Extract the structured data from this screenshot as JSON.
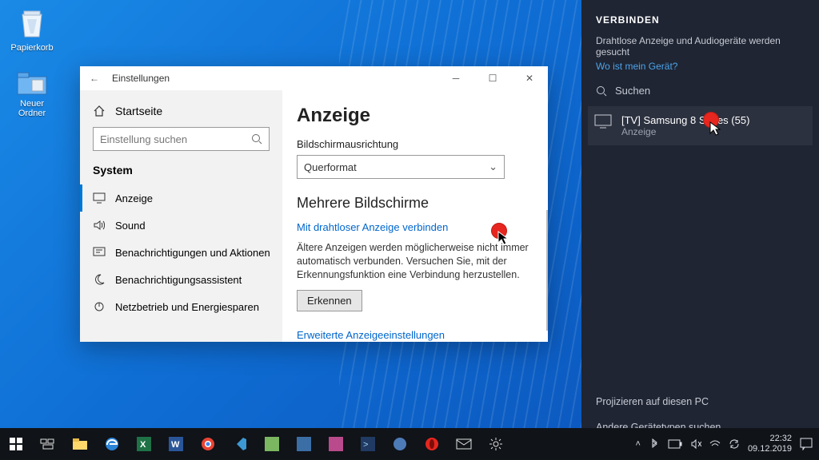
{
  "desktop_icons": {
    "recycle": "Papierkorb",
    "new_folder": "Neuer Ordner"
  },
  "window": {
    "title": "Einstellungen",
    "home": "Startseite",
    "search_placeholder": "Einstellung suchen",
    "group": "System",
    "nav": {
      "display": "Anzeige",
      "sound": "Sound",
      "notif": "Benachrichtigungen und Aktionen",
      "assist": "Benachrichtigungsassistent",
      "power": "Netzbetrieb und Energiesparen"
    },
    "main": {
      "heading": "Anzeige",
      "orient_label": "Bildschirmausrichtung",
      "orient_value": "Querformat",
      "multi_heading": "Mehrere Bildschirme",
      "connect_link": "Mit drahtloser Anzeige verbinden",
      "note": "Ältere Anzeigen werden möglicherweise nicht immer automatisch verbunden. Versuchen Sie, mit der Erkennungsfunktion eine Verbindung herzustellen.",
      "detect": "Erkennen",
      "advanced": "Erweiterte Anzeigeeinstellungen"
    }
  },
  "connect": {
    "title": "VERBINDEN",
    "searching": "Drahtlose Anzeige und Audiogeräte werden gesucht",
    "where": "Wo ist mein Gerät?",
    "search": "Suchen",
    "device_name": "[TV] Samsung 8 Series (55)",
    "device_sub": "Anzeige",
    "project": "Projizieren auf diesen PC",
    "other": "Andere Gerätetypen suchen"
  },
  "tray": {
    "time": "22:32",
    "date": "09.12.2019"
  }
}
